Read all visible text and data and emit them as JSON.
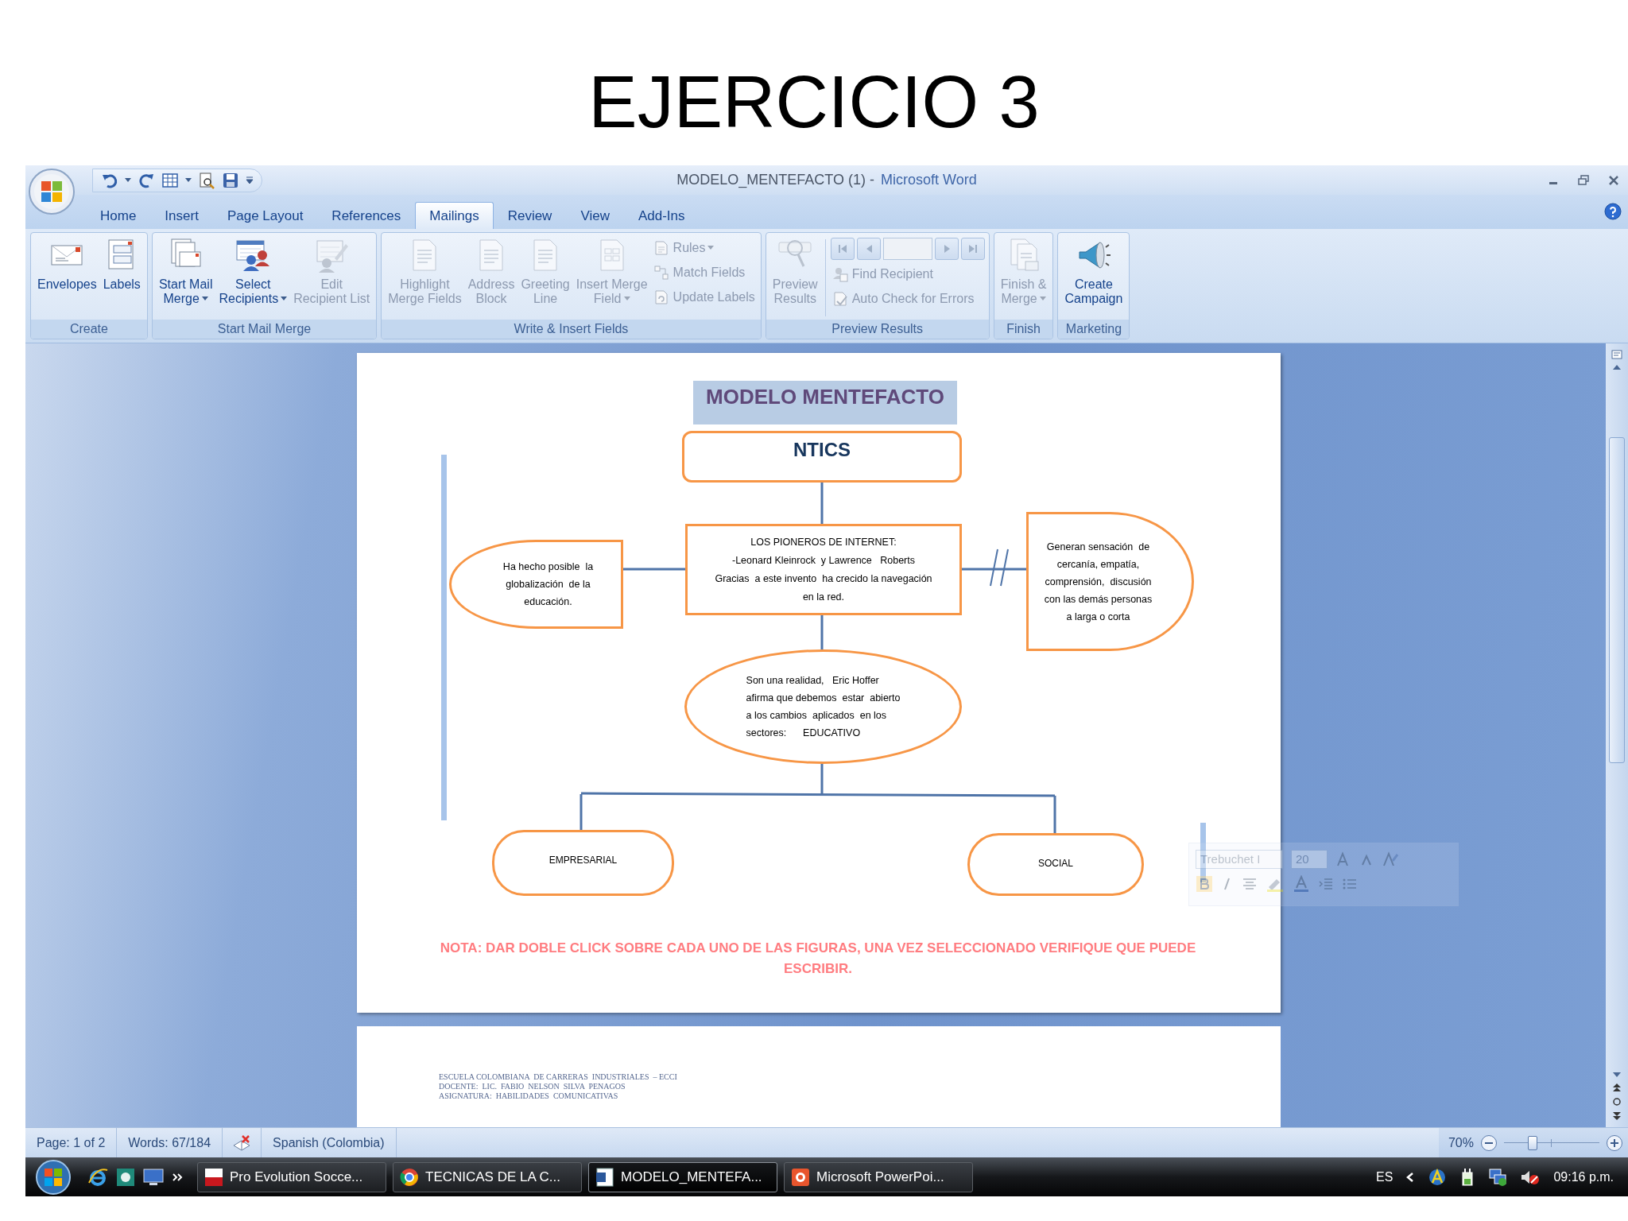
{
  "slide": {
    "title": "EJERCICIO 3"
  },
  "window": {
    "title_document": "MODELO_MENTEFACTO (1) -",
    "title_app": "Microsoft Word"
  },
  "tabs": [
    {
      "label": "Home",
      "selected": false
    },
    {
      "label": "Insert",
      "selected": false
    },
    {
      "label": "Page Layout",
      "selected": false
    },
    {
      "label": "References",
      "selected": false
    },
    {
      "label": "Mailings",
      "selected": true
    },
    {
      "label": "Review",
      "selected": false
    },
    {
      "label": "View",
      "selected": false
    },
    {
      "label": "Add-Ins",
      "selected": false
    }
  ],
  "ribbon": {
    "groups": [
      {
        "label": "Create",
        "buttons": [
          {
            "kind": "large",
            "lines": [
              "Envelopes"
            ],
            "disabled": false,
            "dropdown": false
          },
          {
            "kind": "large",
            "lines": [
              "Labels"
            ],
            "disabled": false,
            "dropdown": false
          }
        ]
      },
      {
        "label": "Start Mail Merge",
        "buttons": [
          {
            "kind": "large",
            "lines": [
              "Start Mail",
              "Merge"
            ],
            "disabled": false,
            "dropdown": true
          },
          {
            "kind": "large",
            "lines": [
              "Select",
              "Recipients"
            ],
            "disabled": false,
            "dropdown": true
          },
          {
            "kind": "large",
            "lines": [
              "Edit",
              "Recipient List"
            ],
            "disabled": true,
            "dropdown": false
          }
        ]
      },
      {
        "label": "Write & Insert Fields",
        "buttons": [
          {
            "kind": "large",
            "lines": [
              "Highlight",
              "Merge Fields"
            ],
            "disabled": true,
            "dropdown": false
          },
          {
            "kind": "large",
            "lines": [
              "Address",
              "Block"
            ],
            "disabled": true,
            "dropdown": false
          },
          {
            "kind": "large",
            "lines": [
              "Greeting",
              "Line"
            ],
            "disabled": true,
            "dropdown": false
          },
          {
            "kind": "large",
            "lines": [
              "Insert Merge",
              "Field"
            ],
            "disabled": true,
            "dropdown": true
          },
          {
            "kind": "small",
            "lines": [
              "Rules"
            ],
            "disabled": true,
            "dropdown": true
          },
          {
            "kind": "small",
            "lines": [
              "Match Fields"
            ],
            "disabled": true,
            "dropdown": false
          },
          {
            "kind": "small",
            "lines": [
              "Update Labels"
            ],
            "disabled": true,
            "dropdown": false
          }
        ]
      },
      {
        "label": "Preview Results",
        "buttons": [
          {
            "kind": "large",
            "lines": [
              "Preview",
              "Results"
            ],
            "disabled": true,
            "dropdown": false
          },
          {
            "kind": "nav",
            "disabled": true
          },
          {
            "kind": "small",
            "lines": [
              "Find Recipient"
            ],
            "disabled": true,
            "dropdown": false
          },
          {
            "kind": "small",
            "lines": [
              "Auto Check for Errors"
            ],
            "disabled": true,
            "dropdown": false
          }
        ]
      },
      {
        "label": "Finish",
        "buttons": [
          {
            "kind": "large",
            "lines": [
              "Finish &",
              "Merge"
            ],
            "disabled": true,
            "dropdown": true
          }
        ]
      },
      {
        "label": "Marketing",
        "buttons": [
          {
            "kind": "large",
            "lines": [
              "Create",
              "Campaign"
            ],
            "disabled": false,
            "dropdown": false
          }
        ]
      }
    ]
  },
  "document": {
    "heading": "MODELO MENTEFACTO",
    "nodes": [
      {
        "kind": "rounded",
        "lines": [
          "NTICS"
        ]
      },
      {
        "kind": "left-arc",
        "lines": [
          "Ha hecho posible  la",
          "globalización  de la",
          "educación."
        ]
      },
      {
        "kind": "rect",
        "lines": [
          "LOS PIONEROS DE INTERNET:",
          "-Leonard Kleinrock  y Lawrence   Roberts",
          "Gracias  a este invento  ha crecido la navegación",
          "en la red."
        ]
      },
      {
        "kind": "right-arc",
        "lines": [
          "Generan sensación  de",
          "cercanía, empatía,",
          "comprensión,  discusión",
          "con las demás personas",
          "a larga o corta"
        ]
      },
      {
        "kind": "ellipse",
        "lines": [
          "Son una realidad,   Eric Hoffer",
          "afirma que debemos  estar  abierto",
          "a los cambios  aplicados  en los",
          "sectores:      EDUCATIVO"
        ]
      },
      {
        "kind": "pill",
        "lines": [
          "EMPRESARIAL"
        ]
      },
      {
        "kind": "pill",
        "lines": [
          "SOCIAL"
        ]
      }
    ],
    "note": "NOTA: DAR DOBLE CLICK SOBRE CADA UNO DE LAS FIGURAS, UNA VEZ SELECCIONADO VERIFIQUE QUE PUEDE ESCRIBIR.",
    "footer": [
      "ESCUELA COLOMBIANA  DE CARRERAS  INDUSTRIALES  – ECCI",
      "DOCENTE:  LIC.  FABIO  NELSON  SILVA  PENAGOS",
      "ASIGNATURA:  HABILIDADES  COMUNICATIVAS"
    ]
  },
  "mini_toolbar": {
    "font": "Trebuchet I",
    "size": "20"
  },
  "status_bar": {
    "items": [
      "Page: 1 of 2",
      "Words: 67/184",
      "Spanish (Colombia)"
    ],
    "zoom": "70%",
    "zoom_slider": {
      "level": 0.3
    }
  },
  "taskbar": {
    "tasks": [
      {
        "label": "Pro Evolution Socce...",
        "selected": false
      },
      {
        "label": "TECNICAS DE LA C...",
        "selected": false
      },
      {
        "label": "MODELO_MENTEFA...",
        "selected": true
      },
      {
        "label": "Microsoft PowerPoi...",
        "selected": false
      }
    ],
    "language": "ES",
    "clock": "09:16 p.m."
  }
}
